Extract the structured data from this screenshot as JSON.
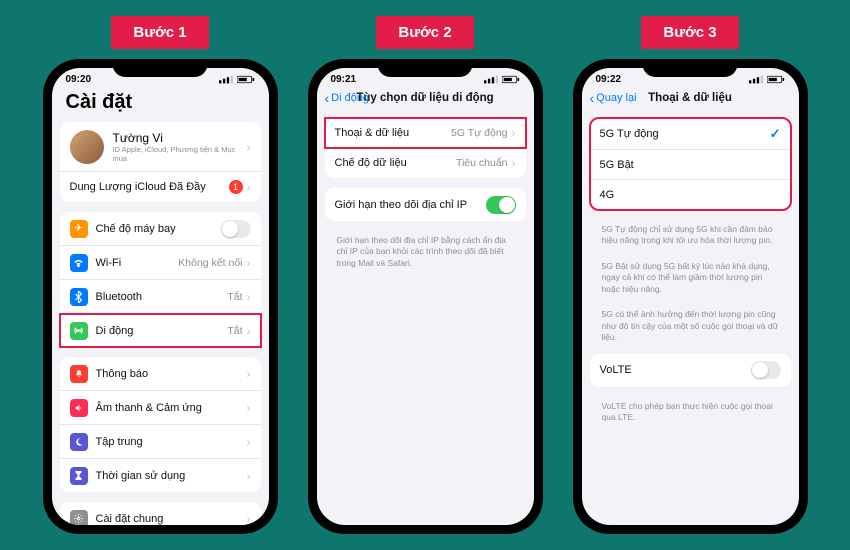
{
  "steps": {
    "s1": "Bước 1",
    "s2": "Bước 2",
    "s3": "Bước 3"
  },
  "status": {
    "time1": "09:20",
    "time2": "09:21",
    "time3": "09:22"
  },
  "p1": {
    "title": "Cài đặt",
    "profile": {
      "name": "Tường Vi",
      "sub": "ID Apple, iCloud, Phương tiện & Mục mua"
    },
    "icloud": {
      "label": "Dung Lượng iCloud Đã Đầy",
      "badge": "1"
    },
    "airplane": "Chế độ máy bay",
    "wifi": {
      "label": "Wi-Fi",
      "value": "Không kết nối"
    },
    "bluetooth": {
      "label": "Bluetooth",
      "value": "Tắt"
    },
    "cellular": {
      "label": "Di động",
      "value": "Tắt"
    },
    "notif": "Thông báo",
    "sound": "Âm thanh & Cảm ứng",
    "focus": "Tập trung",
    "screentime": "Thời gian sử dụng",
    "general": "Cài đặt chung"
  },
  "p2": {
    "back": "Di động",
    "title": "Tùy chọn dữ liệu di động",
    "voiceData": {
      "label": "Thoại & dữ liệu",
      "value": "5G Tự động"
    },
    "dataMode": {
      "label": "Chế độ dữ liệu",
      "value": "Tiêu chuẩn"
    },
    "ipLimit": "Giới hạn theo dõi địa chỉ IP",
    "ipNote": "Giới hạn theo dõi địa chỉ IP bằng cách ẩn địa chỉ IP của bạn khỏi các trình theo dõi đã biết trong Mail và Safari."
  },
  "p3": {
    "back": "Quay lại",
    "title": "Thoại & dữ liệu",
    "opt1": "5G Tự động",
    "opt2": "5G Bật",
    "opt3": "4G",
    "note1": "5G Tự động chỉ sử dụng 5G khi cần đảm bảo hiệu năng trong khi tối ưu hóa thời lượng pin.",
    "note2": "5G Bật sử dụng 5G bất kỳ lúc nào khả dụng, ngay cả khi có thể làm giảm thời lượng pin hoặc hiệu năng.",
    "note3": "5G có thể ảnh hưởng đến thời lượng pin cũng như độ tin cậy của một số cuộc gọi thoại và dữ liệu.",
    "volte": "VoLTE",
    "volteNote": "VoLTE cho phép bạn thực hiện cuộc gọi thoại qua LTE."
  }
}
